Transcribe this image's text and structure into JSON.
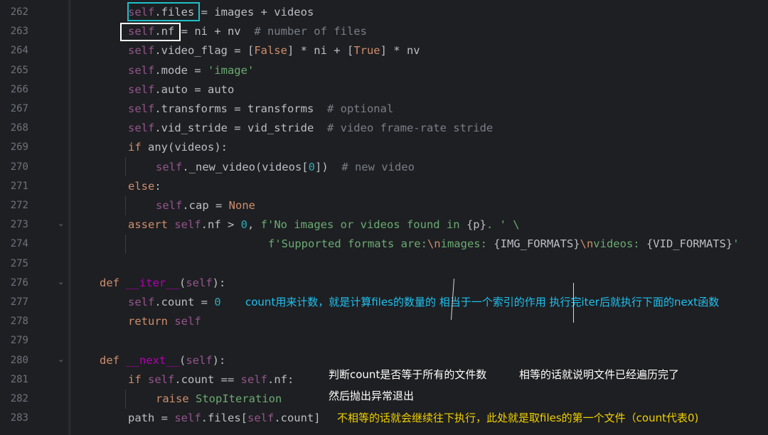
{
  "lines": [
    {
      "n": "262",
      "fold": "",
      "indent": 180,
      "tokens": [
        [
          "self",
          "self"
        ],
        [
          ".files = images + videos",
          ""
        ]
      ]
    },
    {
      "n": "263",
      "fold": "",
      "indent": 180,
      "tokens": [
        [
          "self",
          "self"
        ],
        [
          ".nf = ni + nv  ",
          ""
        ],
        [
          "# number of files",
          "cm"
        ]
      ]
    },
    {
      "n": "264",
      "fold": "",
      "indent": 180,
      "tokens": [
        [
          "self",
          "self"
        ],
        [
          ".video_flag = [",
          ""
        ],
        [
          "False",
          "kw"
        ],
        [
          "] * ni + [",
          ""
        ],
        [
          "True",
          "kw"
        ],
        [
          "] * nv",
          ""
        ]
      ]
    },
    {
      "n": "265",
      "fold": "",
      "indent": 180,
      "tokens": [
        [
          "self",
          "self"
        ],
        [
          ".mode = ",
          ""
        ],
        [
          "'image'",
          "str"
        ]
      ]
    },
    {
      "n": "266",
      "fold": "",
      "indent": 180,
      "tokens": [
        [
          "self",
          "self"
        ],
        [
          ".auto = auto",
          ""
        ]
      ]
    },
    {
      "n": "267",
      "fold": "",
      "indent": 180,
      "tokens": [
        [
          "self",
          "self"
        ],
        [
          ".transforms = transforms  ",
          ""
        ],
        [
          "# optional",
          "cm"
        ]
      ]
    },
    {
      "n": "268",
      "fold": "",
      "indent": 180,
      "tokens": [
        [
          "self",
          "self"
        ],
        [
          ".vid_stride = vid_stride  ",
          ""
        ],
        [
          "# video frame-rate stride",
          "cm"
        ]
      ]
    },
    {
      "n": "269",
      "fold": "",
      "indent": 180,
      "tokens": [
        [
          "if ",
          "kw"
        ],
        [
          "any(videos):",
          ""
        ]
      ]
    },
    {
      "n": "270",
      "fold": "",
      "indent": 219,
      "tokens": [
        [
          "self",
          "self"
        ],
        [
          "._new_video(videos[",
          ""
        ],
        [
          "0",
          "num"
        ],
        [
          "])  ",
          ""
        ],
        [
          "# new video",
          "cm"
        ]
      ]
    },
    {
      "n": "271",
      "fold": "",
      "indent": 180,
      "tokens": [
        [
          "else",
          "kw"
        ],
        [
          ":",
          ""
        ]
      ]
    },
    {
      "n": "272",
      "fold": "",
      "indent": 219,
      "tokens": [
        [
          "self",
          "self"
        ],
        [
          ".cap = ",
          ""
        ],
        [
          "None",
          "kw"
        ]
      ]
    },
    {
      "n": "273",
      "fold": "›",
      "indent": 180,
      "tokens": [
        [
          "assert ",
          "kw"
        ],
        [
          "self",
          "self"
        ],
        [
          ".nf > ",
          ""
        ],
        [
          "0",
          "num"
        ],
        [
          ", ",
          ""
        ],
        [
          "f'No images or videos found in ",
          "str"
        ],
        [
          "{p}",
          ""
        ],
        [
          ". ' \\",
          "str"
        ]
      ]
    },
    {
      "n": "274",
      "fold": "",
      "indent": 377,
      "tokens": [
        [
          "f'Supported formats are:",
          "str"
        ],
        [
          "\\n",
          "kw"
        ],
        [
          "images: ",
          "str"
        ],
        [
          "{IMG_FORMATS}",
          ""
        ],
        [
          "\\n",
          "kw"
        ],
        [
          "videos: ",
          "str"
        ],
        [
          "{VID_FORMATS}",
          ""
        ],
        [
          "'",
          "str"
        ]
      ]
    },
    {
      "n": "275",
      "fold": "",
      "indent": 140,
      "tokens": []
    },
    {
      "n": "276",
      "fold": "›",
      "indent": 140,
      "tokens": [
        [
          "def ",
          "kw"
        ],
        [
          "__iter__",
          "dn"
        ],
        [
          "(",
          ""
        ],
        [
          "self",
          "self"
        ],
        [
          "):",
          ""
        ]
      ]
    },
    {
      "n": "277",
      "fold": "",
      "indent": 180,
      "tokens": [
        [
          "self",
          "self"
        ],
        [
          ".count = ",
          ""
        ],
        [
          "0",
          "num"
        ]
      ]
    },
    {
      "n": "278",
      "fold": "",
      "indent": 180,
      "tokens": [
        [
          "return ",
          "kw"
        ],
        [
          "self",
          "self"
        ]
      ]
    },
    {
      "n": "279",
      "fold": "",
      "indent": 140,
      "tokens": []
    },
    {
      "n": "280",
      "fold": "›",
      "indent": 140,
      "tokens": [
        [
          "def ",
          "kw"
        ],
        [
          "__next__",
          "dn"
        ],
        [
          "(",
          ""
        ],
        [
          "self",
          "self"
        ],
        [
          "):",
          ""
        ]
      ]
    },
    {
      "n": "281",
      "fold": "",
      "indent": 180,
      "tokens": [
        [
          "if ",
          "kw"
        ],
        [
          "self",
          "self"
        ],
        [
          ".count == ",
          ""
        ],
        [
          "self",
          "self"
        ],
        [
          ".nf:",
          ""
        ]
      ]
    },
    {
      "n": "282",
      "fold": "",
      "indent": 219,
      "tokens": [
        [
          "raise ",
          "kw"
        ],
        [
          "StopIteration",
          "str"
        ]
      ]
    },
    {
      "n": "283",
      "fold": "",
      "indent": 180,
      "tokens": [
        [
          "path = ",
          ""
        ],
        [
          "self",
          "self"
        ],
        [
          ".files[",
          ""
        ],
        [
          "self",
          "self"
        ],
        [
          ".count]",
          ""
        ]
      ]
    }
  ],
  "annotations": {
    "iter_note": "count用来计数，就是计算files的数量的 相当于一个索引的作用 执行完iter后就执行下面的next函数",
    "next_note1": "判断count是否等于所有的文件数",
    "next_note2": "相等的话就说明文件已经遍历完了",
    "next_note3": "然后抛出异常退出",
    "path_note": "不相等的话就会继续往下执行，此处就是取files的第一个文件（count代表0)"
  },
  "colors": {
    "background": "#1e1f22",
    "keyword": "#cf8e6d",
    "self": "#94558d",
    "string": "#6aab73",
    "number": "#2aacb8",
    "comment": "#7a7e85",
    "dunder": "#b200b2",
    "note_cyan": "#1fc0f0",
    "note_white": "#ffffff",
    "note_yellow": "#f0d000"
  }
}
